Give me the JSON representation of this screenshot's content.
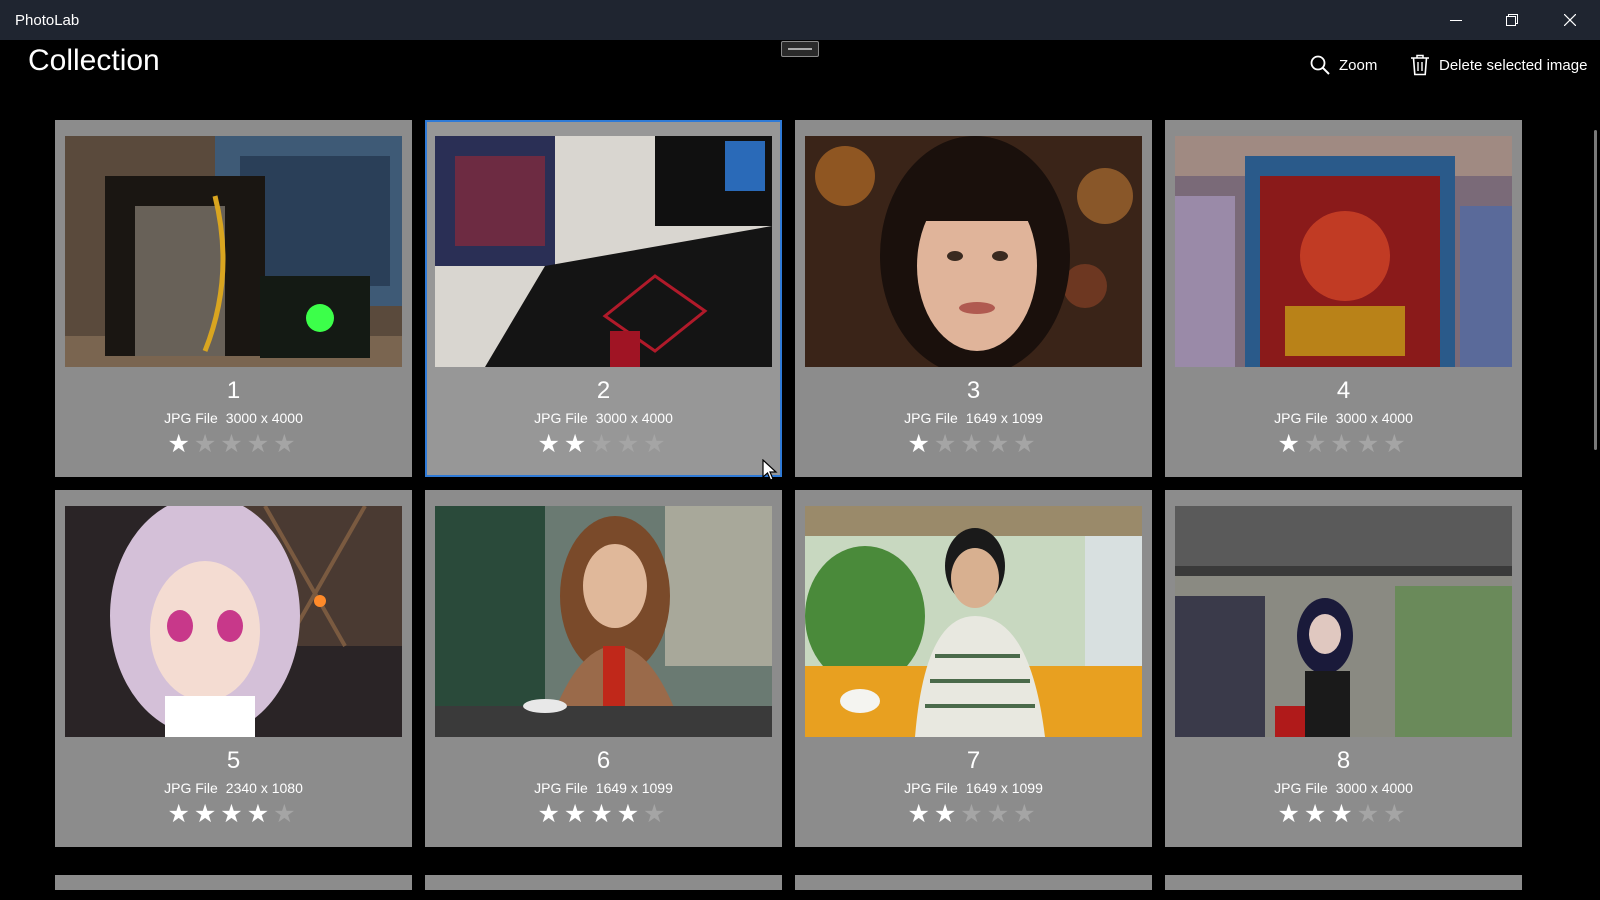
{
  "window": {
    "title": "PhotoLab",
    "controls": [
      "minimize",
      "restore",
      "close"
    ]
  },
  "page": {
    "title": "Collection"
  },
  "commands": {
    "zoom_label": "Zoom",
    "delete_label": "Delete selected image"
  },
  "images": [
    {
      "name": "1",
      "type": "JPG File",
      "dimensions": "3000 x 4000",
      "rating": 1,
      "max_rating": 5,
      "selected": false
    },
    {
      "name": "2",
      "type": "JPG File",
      "dimensions": "3000 x 4000",
      "rating": 2,
      "max_rating": 5,
      "selected": true
    },
    {
      "name": "3",
      "type": "JPG File",
      "dimensions": "1649 x 1099",
      "rating": 1,
      "max_rating": 5,
      "selected": false
    },
    {
      "name": "4",
      "type": "JPG File",
      "dimensions": "3000 x 4000",
      "rating": 1,
      "max_rating": 5,
      "selected": false
    },
    {
      "name": "5",
      "type": "JPG File",
      "dimensions": "2340 x 1080",
      "rating": 4,
      "max_rating": 5,
      "selected": false
    },
    {
      "name": "6",
      "type": "JPG File",
      "dimensions": "1649 x 1099",
      "rating": 4,
      "max_rating": 5,
      "selected": false
    },
    {
      "name": "7",
      "type": "JPG File",
      "dimensions": "1649 x 1099",
      "rating": 2,
      "max_rating": 5,
      "selected": false
    },
    {
      "name": "8",
      "type": "JPG File",
      "dimensions": "3000 x 4000",
      "rating": 3,
      "max_rating": 5,
      "selected": false
    }
  ],
  "colors": {
    "titlebar": "#1f2530",
    "background": "#000000",
    "card": "#8c8c8c",
    "selection_accent": "#2f7ad6",
    "star_on": "#ffffff",
    "star_off": "#a5a5a5"
  }
}
